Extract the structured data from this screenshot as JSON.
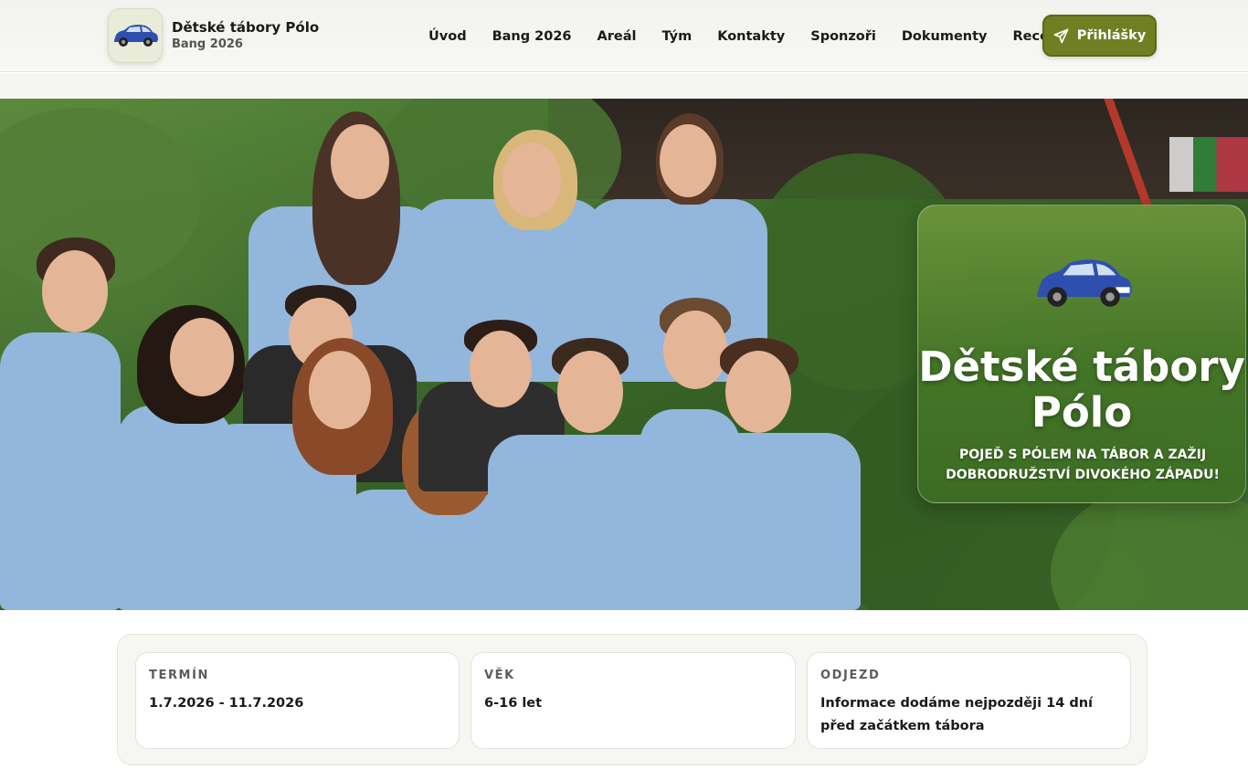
{
  "brand": {
    "title": "Dětské tábory Pólo",
    "subtitle": "Bang 2026",
    "logo_icon": "blue-car-icon"
  },
  "nav": {
    "items": [
      {
        "label": "Úvod"
      },
      {
        "label": "Bang 2026"
      },
      {
        "label": "Areál"
      },
      {
        "label": "Tým"
      },
      {
        "label": "Kontakty"
      },
      {
        "label": "Sponzoři"
      },
      {
        "label": "Dokumenty"
      },
      {
        "label": "Recenze"
      }
    ],
    "cta": {
      "label": "Přihlášky",
      "icon": "paper-plane-icon",
      "color": "#6f7f22"
    }
  },
  "hero": {
    "image": "group-photo-camp-team",
    "card": {
      "title": "Dětské tábory Pólo",
      "subtitle": "POJEĎ S PÓLEM NA TÁBOR A ZAŽIJ DOBRODRUŽSTVÍ DIVOKÉHO ZÁPADU!",
      "icon": "blue-car-icon"
    }
  },
  "facts": [
    {
      "label": "TERMÍN",
      "value": "1.7.2026 - 11.7.2026"
    },
    {
      "label": "VĚK",
      "value": "6-16 let"
    },
    {
      "label": "ODJEZD",
      "value": "Informace dodáme nejpozději 14 dní před začátkem tábora"
    }
  ],
  "colors": {
    "accent": "#6f7f22",
    "shirt": "#93b6dc",
    "car": "#2f4fb0"
  }
}
